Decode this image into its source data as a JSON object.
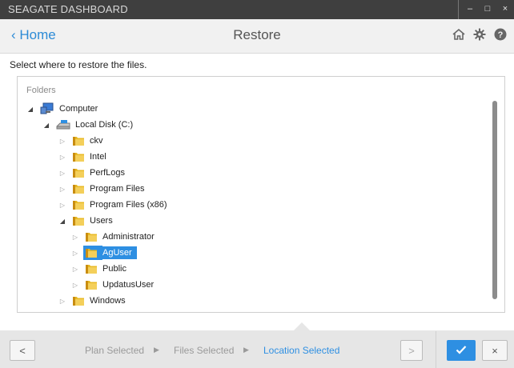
{
  "window": {
    "title": "SEAGATE DASHBOARD",
    "minimize": "–",
    "maximize": "□",
    "close": "×"
  },
  "nav": {
    "back_label": "‹ Home",
    "page_title": "Restore",
    "icons": [
      "home-icon",
      "gear-icon",
      "help-icon"
    ]
  },
  "instruction": "Select where to restore the files.",
  "tree": {
    "section_label": "Folders",
    "nodes": [
      {
        "label": "Computer",
        "icon": "computer-icon",
        "expanded": true,
        "selected": false
      },
      {
        "label": "Local Disk (C:)",
        "icon": "drive-icon",
        "expanded": true,
        "selected": false
      },
      {
        "label": "ckv",
        "icon": "folder-icon",
        "expanded": false,
        "selected": false
      },
      {
        "label": "Intel",
        "icon": "folder-icon",
        "expanded": false,
        "selected": false
      },
      {
        "label": "PerfLogs",
        "icon": "folder-icon",
        "expanded": false,
        "selected": false
      },
      {
        "label": "Program Files",
        "icon": "folder-icon",
        "expanded": false,
        "selected": false
      },
      {
        "label": "Program Files (x86)",
        "icon": "folder-icon",
        "expanded": false,
        "selected": false
      },
      {
        "label": "Users",
        "icon": "folder-icon",
        "expanded": true,
        "selected": false
      },
      {
        "label": "Administrator",
        "icon": "folder-icon",
        "expanded": false,
        "selected": false
      },
      {
        "label": "AgUser",
        "icon": "folder-icon",
        "expanded": false,
        "selected": true
      },
      {
        "label": "Public",
        "icon": "folder-icon",
        "expanded": false,
        "selected": false
      },
      {
        "label": "UpdatusUser",
        "icon": "folder-icon",
        "expanded": false,
        "selected": false
      },
      {
        "label": "Windows",
        "icon": "folder-icon",
        "expanded": false,
        "selected": false
      }
    ]
  },
  "wizard": {
    "back": "<",
    "steps": [
      "Plan Selected",
      "Files Selected",
      "Location Selected"
    ],
    "active_step": "Location Selected",
    "next": ">",
    "confirm_icon": "checkmark-icon",
    "cancel": "×"
  },
  "colors": {
    "accent": "#2e8fe2",
    "titlebar": "#3f3f3f",
    "folder": "#e8b923"
  }
}
